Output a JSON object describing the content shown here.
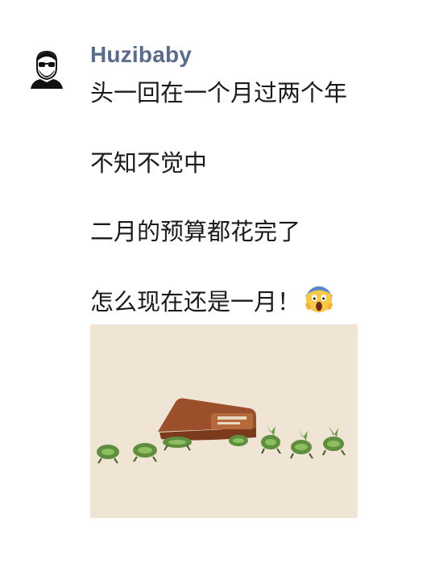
{
  "post": {
    "author": "Huzibaby",
    "lines": [
      "头一回在一个月过两个年",
      "不知不觉中",
      "二月的预算都花完了",
      "怎么现在还是一月！"
    ],
    "trailing_emoji": "screaming-face-icon",
    "image": {
      "subject": "wallet with money running away",
      "background_color": "#efe3d3",
      "wallet_color": "#a0522d",
      "money_color": "#5f8f3e"
    }
  }
}
